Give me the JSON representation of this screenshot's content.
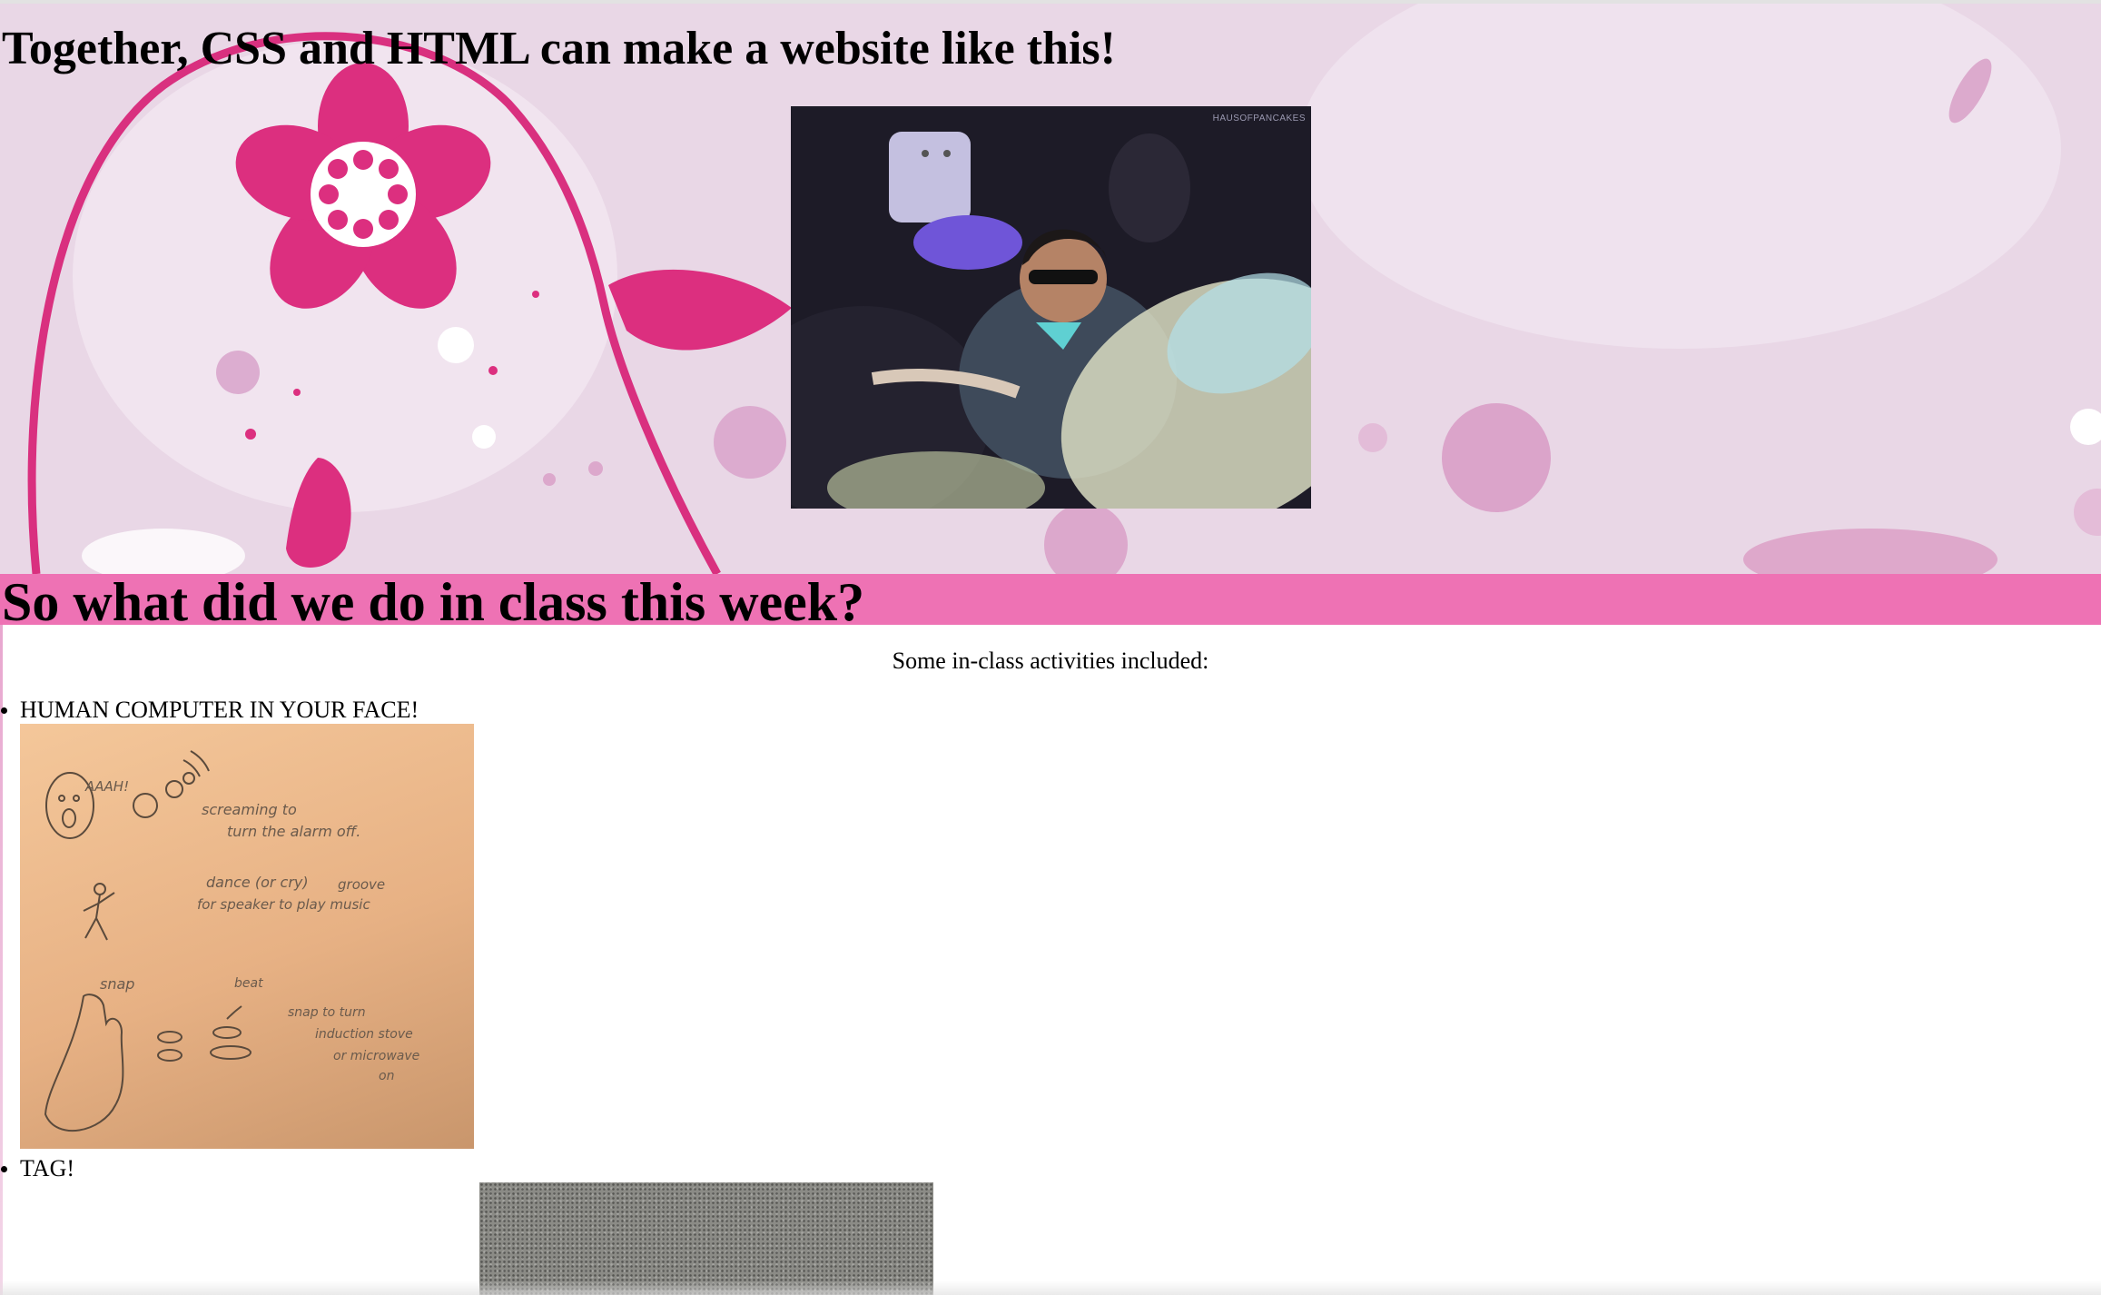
{
  "page": {
    "heading": "Together, CSS and HTML can make a website like this!",
    "gif_watermark": "HAUSOFPANCAKES"
  },
  "section": {
    "heading": "So what did we do in class this week?",
    "intro": "Some in-class activities included:"
  },
  "activities": [
    {
      "label": "HUMAN COMPUTER IN YOUR FACE!",
      "image": "hand-drawn-sketch-photo"
    },
    {
      "label": "TAG!",
      "image": "carpet-photo"
    }
  ],
  "sketch_notes": {
    "scream_sound": "AAAH!",
    "note_1": [
      "screaming to",
      "turn the alarm off."
    ],
    "note_2": [
      "dance (or cry)",
      "for speaker to play music"
    ],
    "note_2_extra": "groove",
    "snap_word": "snap",
    "beat_word": "beat",
    "note_3": [
      "snap to turn",
      "induction stove",
      "or microwave",
      "on"
    ]
  },
  "colors": {
    "hero_background": "#e9d7e6",
    "magenta_accent": "#d9307f",
    "section_bar": "#ee72b4"
  }
}
